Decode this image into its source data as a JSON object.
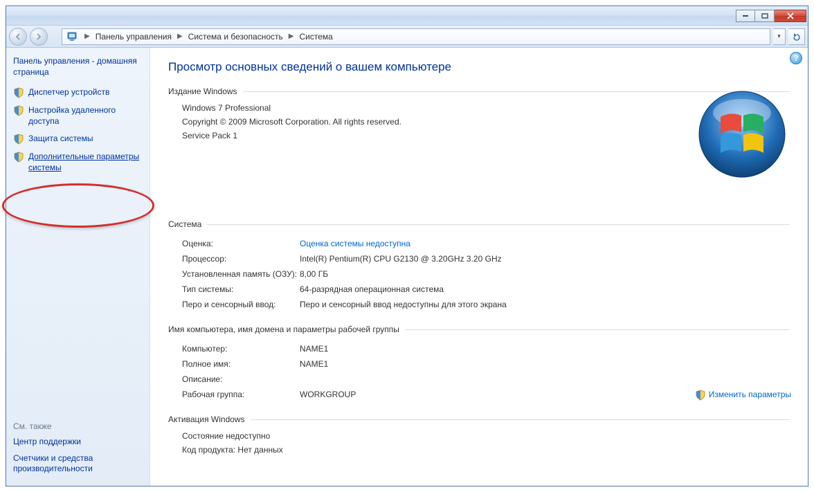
{
  "breadcrumb": {
    "seg1": "Панель управления",
    "seg2": "Система и безопасность",
    "seg3": "Система"
  },
  "sidebar": {
    "home": "Панель управления - домашняя страница",
    "items": [
      {
        "label": "Диспетчер устройств"
      },
      {
        "label": "Настройка удаленного доступа"
      },
      {
        "label": "Защита системы"
      },
      {
        "label": "Дополнительные параметры системы"
      }
    ],
    "see_also_hdr": "См. также",
    "see_also": [
      "Центр поддержки",
      "Счетчики и средства производительности"
    ]
  },
  "main": {
    "title": "Просмотр основных сведений о вашем компьютере",
    "edition_hdr": "Издание Windows",
    "edition_name": "Windows 7 Professional",
    "copyright": "Copyright © 2009 Microsoft Corporation.  All rights reserved.",
    "sp": "Service Pack 1",
    "system_hdr": "Система",
    "rating_k": "Оценка:",
    "rating_v": "Оценка системы недоступна",
    "cpu_k": "Процессор:",
    "cpu_v": "Intel(R) Pentium(R) CPU G2130 @ 3.20GHz   3.20 GHz",
    "ram_k": "Установленная память (ОЗУ):",
    "ram_v": "8,00 ГБ",
    "type_k": "Тип системы:",
    "type_v": "64-разрядная операционная система",
    "pen_k": "Перо и сенсорный ввод:",
    "pen_v": "Перо и сенсорный ввод недоступны для этого экрана",
    "domain_hdr": "Имя компьютера, имя домена и параметры рабочей группы",
    "computer_k": "Компьютер:",
    "computer_v": "NAME1",
    "fullname_k": "Полное имя:",
    "fullname_v": "NAME1",
    "desc_k": "Описание:",
    "desc_v": "",
    "workgroup_k": "Рабочая группа:",
    "workgroup_v": "WORKGROUP",
    "change_settings": "Изменить параметры",
    "activation_hdr": "Активация Windows",
    "activation_state": "Состояние недоступно",
    "product_key": "Код продукта:  Нет данных"
  }
}
